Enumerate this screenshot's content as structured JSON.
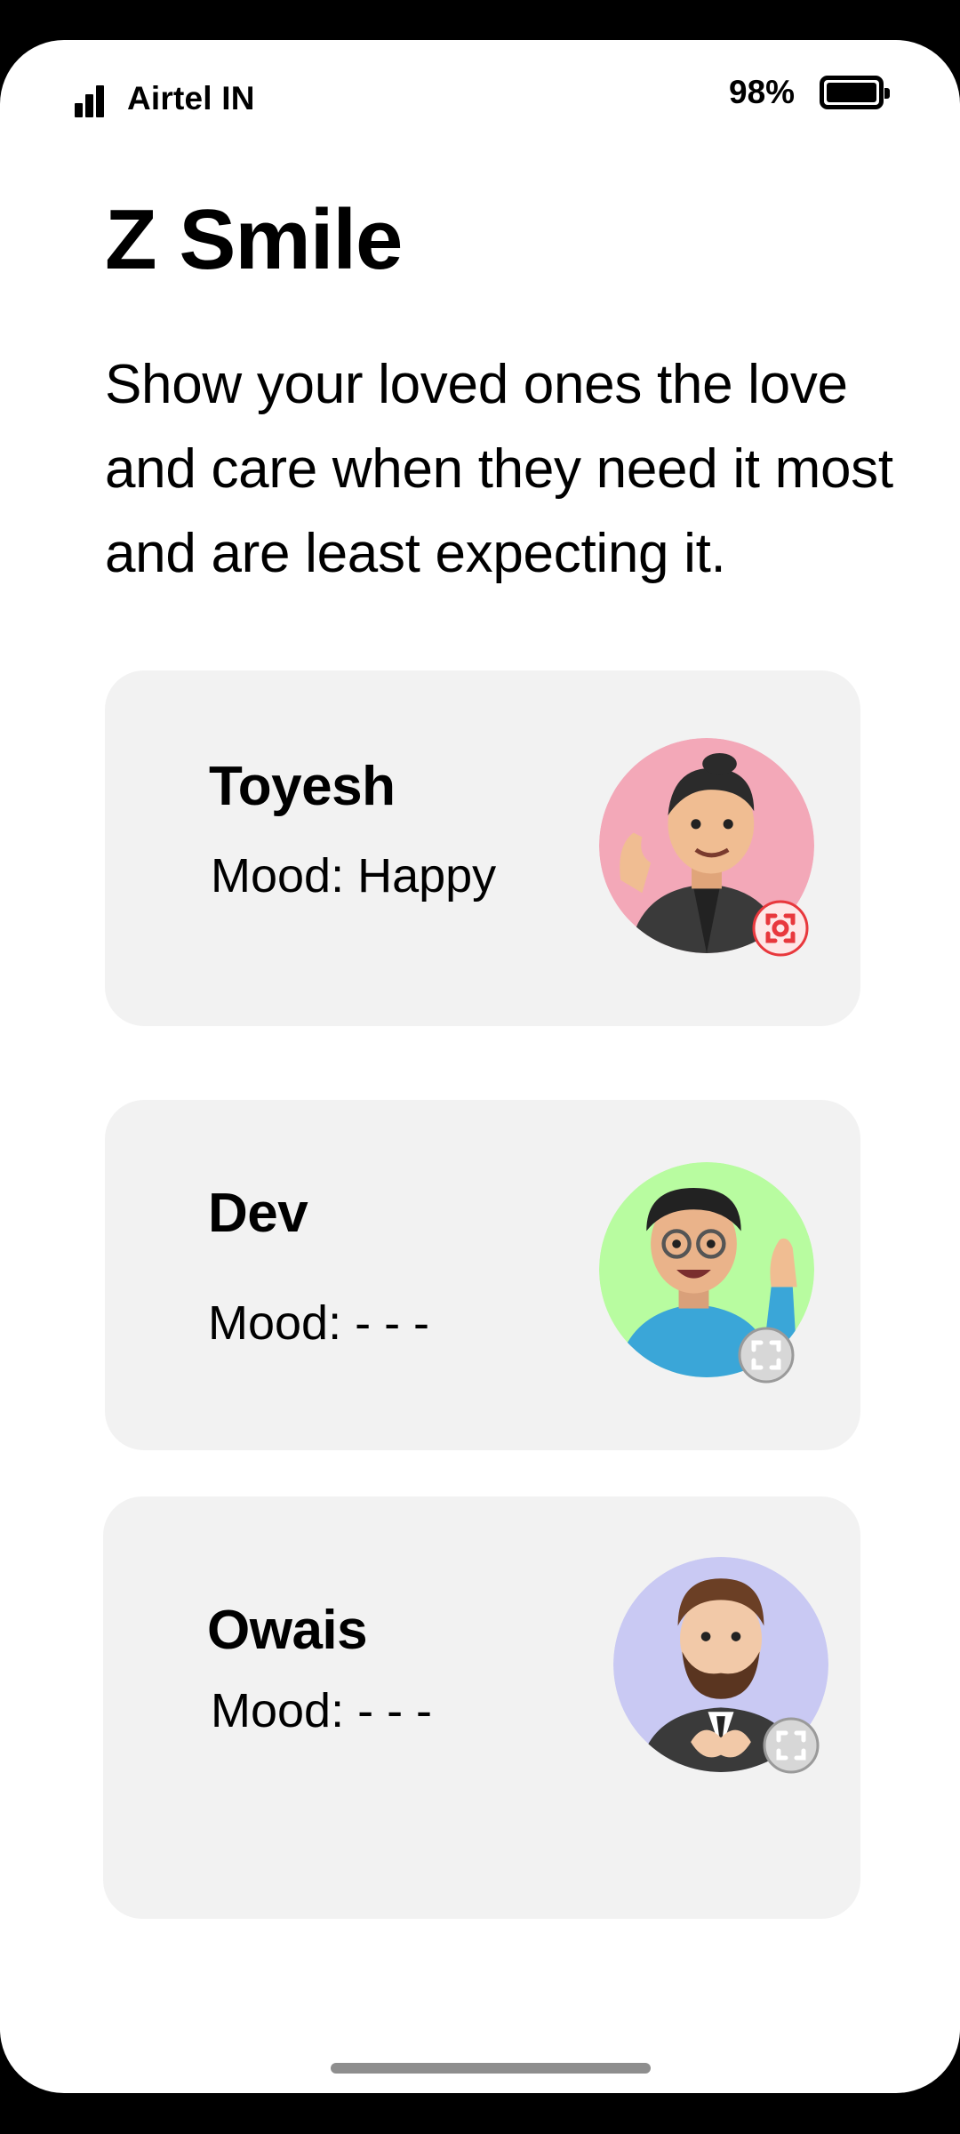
{
  "status_bar": {
    "carrier": "Airtel IN",
    "battery_percent": "98%",
    "signal_icon": "signal-bars-icon",
    "battery_icon": "battery-icon"
  },
  "app": {
    "title": "Z Smile",
    "description": "Show your loved ones the love and care when they need it most and are least expecting it."
  },
  "contacts": [
    {
      "name": "Toyesh",
      "mood": "Mood: Happy",
      "avatar_bg": "#f3a8b8",
      "badge_status": "active",
      "badge_color": "#e8383d"
    },
    {
      "name": "Dev",
      "mood": "Mood: - - -",
      "avatar_bg": "#b8fca0",
      "badge_status": "inactive",
      "badge_color": "#9a9a9a"
    },
    {
      "name": "Owais",
      "mood": "Mood: - - -",
      "avatar_bg": "#c9c9f3",
      "badge_status": "inactive",
      "badge_color": "#9a9a9a"
    }
  ],
  "colors": {
    "card_background": "#f2f2f2",
    "screen_background": "#ffffff"
  }
}
